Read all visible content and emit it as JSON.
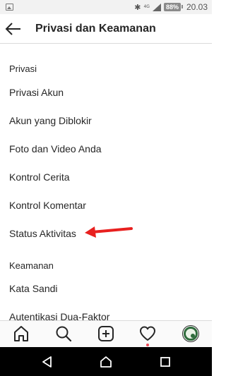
{
  "status_bar": {
    "network_label": "4G",
    "battery": "88%",
    "time": "20.03"
  },
  "header": {
    "title": "Privasi dan Keamanan"
  },
  "sections": [
    {
      "title": "Privasi",
      "items": [
        {
          "label": "Privasi Akun"
        },
        {
          "label": "Akun yang Diblokir"
        },
        {
          "label": "Foto dan Video Anda"
        },
        {
          "label": "Kontrol Cerita"
        },
        {
          "label": "Kontrol Komentar"
        },
        {
          "label": "Status Aktivitas"
        }
      ]
    },
    {
      "title": "Keamanan",
      "items": [
        {
          "label": "Kata Sandi"
        },
        {
          "label": "Autentikasi Dua-Faktor"
        }
      ]
    }
  ],
  "annotation": {
    "arrow_color": "#e8201f",
    "points_to": "Status Aktivitas"
  },
  "bottom_nav": {
    "items": [
      "home-icon",
      "search-icon",
      "new-post-icon",
      "activity-heart-icon",
      "profile-avatar"
    ],
    "notification_dot_color": "#ed4956"
  },
  "system_nav": {
    "items": [
      "back-triangle-icon",
      "home-circle-icon",
      "recents-square-icon"
    ]
  }
}
